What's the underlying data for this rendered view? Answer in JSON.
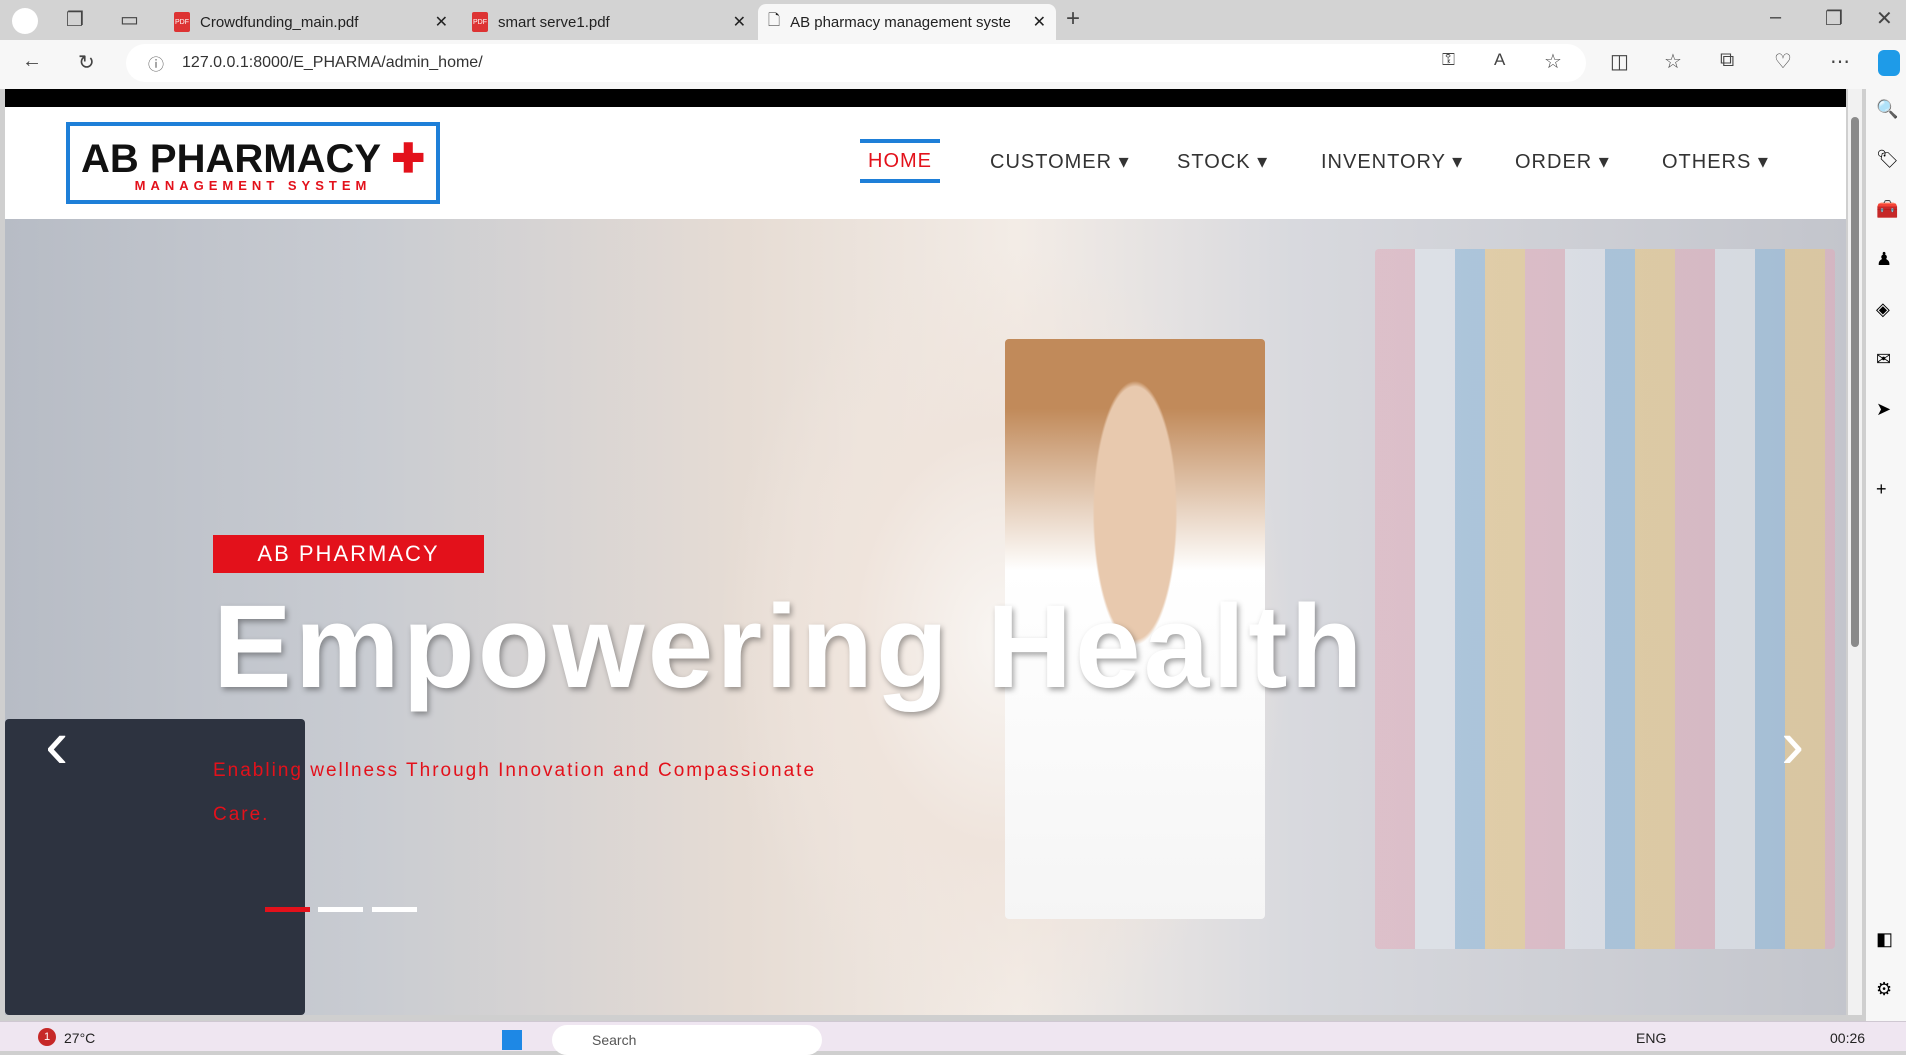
{
  "browser": {
    "tabs": [
      {
        "title": "Crowdfunding_main.pdf"
      },
      {
        "title": "smart serve1.pdf"
      },
      {
        "title": "AB pharmacy management syste"
      }
    ],
    "url": "127.0.0.1:8000/E_PHARMA/admin_home/"
  },
  "logo": {
    "title": "AB PHARMACY",
    "subtitle": "MANAGEMENT SYSTEM"
  },
  "nav": [
    {
      "label": "HOME",
      "active": true
    },
    {
      "label": "CUSTOMER ▾"
    },
    {
      "label": "STOCK ▾"
    },
    {
      "label": "INVENTORY ▾"
    },
    {
      "label": "ORDER ▾"
    },
    {
      "label": "OTHERS ▾"
    }
  ],
  "hero": {
    "badge": "AB PHARMACY",
    "headline": "Empowering Health",
    "subtitle": "Enabling wellness Through Innovation and Compassionate Care.",
    "slides": 3,
    "active_slide": 1
  },
  "taskbar": {
    "weather": "27°C",
    "weather_badge": "1",
    "search": "Search",
    "lang": "ENG",
    "time": "00:26"
  },
  "colors": {
    "accent": "#e3111b",
    "nav_border": "#1e7fd8"
  }
}
